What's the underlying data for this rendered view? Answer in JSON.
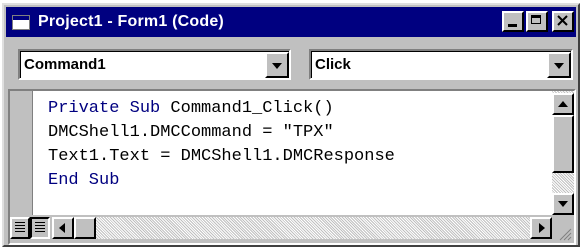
{
  "window": {
    "title": "Project1 - Form1 (Code)"
  },
  "object_combo": {
    "value": "Command1"
  },
  "procedure_combo": {
    "value": "Click"
  },
  "code": {
    "lines": [
      {
        "keyword": "Private Sub",
        "rest": " Command1_Click()"
      },
      {
        "keyword": "",
        "rest": "DMCShell1.DMCCommand = \"TPX\""
      },
      {
        "keyword": "",
        "rest": "Text1.Text = DMCShell1.DMCResponse"
      },
      {
        "keyword": "End Sub",
        "rest": ""
      }
    ]
  },
  "colors": {
    "titlebar": "#000080",
    "keyword": "#000080",
    "chrome": "#c0c0c0"
  },
  "icons": [
    "app-icon",
    "minimize-icon",
    "maximize-icon",
    "close-icon",
    "procedure-view-icon",
    "full-module-view-icon",
    "resize-grip-icon"
  ]
}
